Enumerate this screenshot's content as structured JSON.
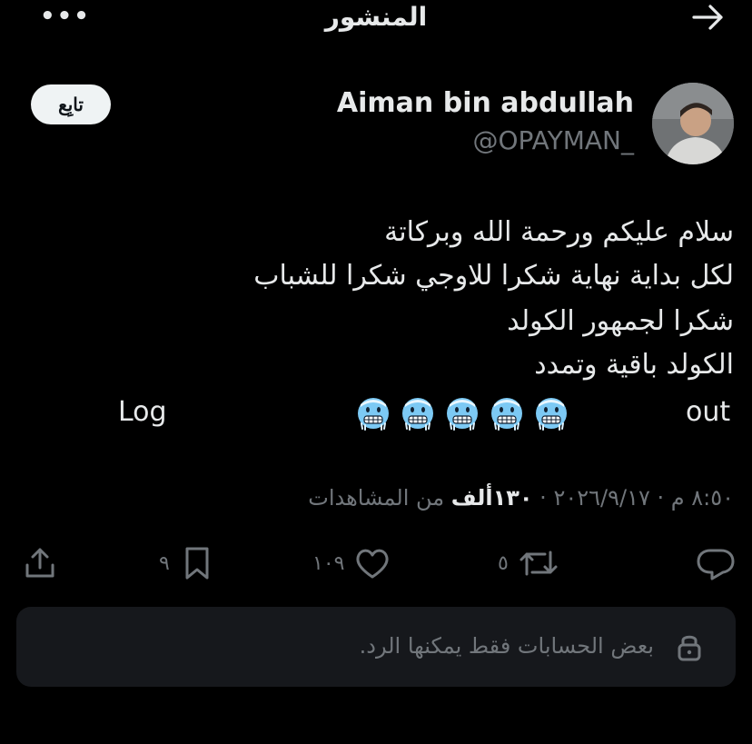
{
  "header": {
    "title": "المنشور",
    "more_label": "•••"
  },
  "author": {
    "name": "Aiman bin abdullah",
    "handle": "@OPAYMAN_",
    "follow_label": "تابِع"
  },
  "post": {
    "lines": [
      "سلام عليكم ورحمة الله وبركاتة",
      "لكل بداية نهاية شكرا للاوجي شكرا للشباب",
      "شكرا لجمهور الكولد",
      "الكولد باقية وتمدد"
    ],
    "log_text": "Log",
    "out_text": "out",
    "emoji_count": 5,
    "emoji_name": "cold-face"
  },
  "meta": {
    "date_time": "٨:٥٠ م · ٢٠٢٦/٩/١٧",
    "views_count": "١٣٠ألف",
    "views_label": "من المشاهدات"
  },
  "actions": {
    "reposts": "٥",
    "likes": "١٠٩",
    "bookmarks": "٩"
  },
  "reply_restriction": {
    "text": "بعض الحسابات فقط يمكنها الرد."
  },
  "colors": {
    "background": "#000000",
    "muted": "#71767b",
    "text": "#e7e9ea",
    "emoji": "#7cc9f4"
  }
}
